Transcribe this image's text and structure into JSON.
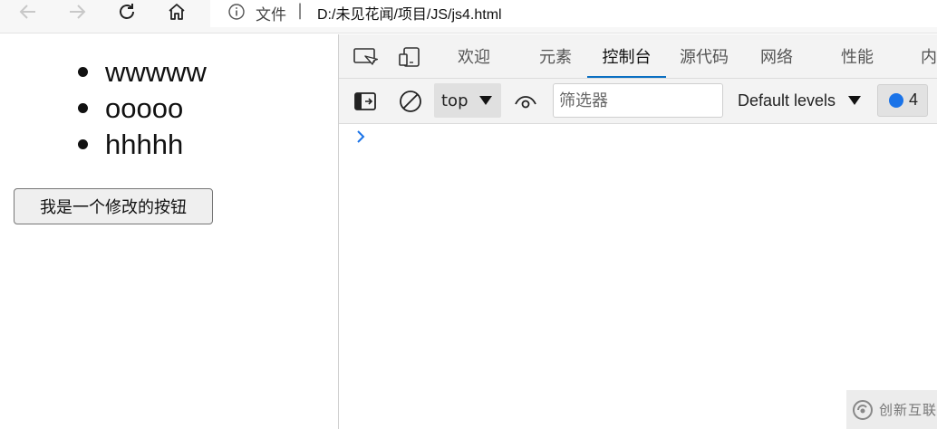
{
  "browser": {
    "address_file_label": "文件",
    "address_separator": "|",
    "url": "D:/未见花闻/项目/JS/js4.html",
    "icons": [
      "back-arrow-icon",
      "forward-arrow-icon",
      "refresh-icon",
      "home-icon",
      "info-icon"
    ]
  },
  "page": {
    "list_items": [
      "wwwww",
      "ooooo",
      "hhhhh"
    ],
    "button_label": "我是一个修改的按钮"
  },
  "devtools": {
    "tabs": [
      "欢迎",
      "元素",
      "控制台",
      "源代码",
      "网络",
      "性能",
      "内"
    ],
    "active_tab": "控制台",
    "context": "top",
    "filter_placeholder": "筛选器",
    "filter_value": "",
    "levels_label": "Default levels",
    "issues_count": "4",
    "prompt_symbol": "›",
    "accent_color": "#0a6fc2"
  },
  "watermark": {
    "text": "创新互联"
  }
}
